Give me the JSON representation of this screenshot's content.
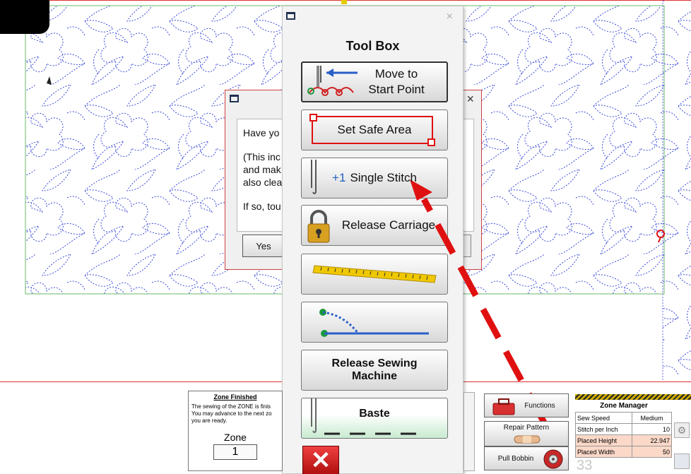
{
  "toolbox": {
    "title": "Tool Box",
    "close": "×",
    "buttons": {
      "move_to_start": [
        "Move to",
        "Start Point"
      ],
      "set_safe_area": "Set Safe Area",
      "single_stitch_prefix": "+1",
      "single_stitch": "Single Stitch",
      "release_carriage": "Release Carriage",
      "release_sewing_machine": [
        "Release Sewing",
        "Machine"
      ],
      "baste": "Baste",
      "cancel": "✕"
    }
  },
  "confirm_dialog": {
    "close": "×",
    "lines": [
      "Have yo",
      "(This inc",
      "and mak",
      "also clea",
      "If so, tou"
    ],
    "yes": "Yes"
  },
  "zone_panel": {
    "heading": "Zone Finished",
    "message": [
      "The sewing of the ZONE is finis",
      "You may advance to the next zo",
      "you are ready."
    ],
    "zone_label": "Zone",
    "zone_number": "1"
  },
  "side_buttons": {
    "functions": "Functions",
    "repair_pattern": "Repair Pattern",
    "pull_bobbin": "Pull Bobbin"
  },
  "zone_manager": {
    "title": "Zone Manager",
    "rows": [
      {
        "label": "Sew Speed",
        "value": "Medium"
      },
      {
        "label": "Stitch per Inch",
        "value": "10"
      },
      {
        "label": "Placed Height",
        "value": "22.947"
      },
      {
        "label": "Placed Width",
        "value": "50"
      }
    ]
  },
  "page_number": "33",
  "colors": {
    "stitch": "#3a4ad8",
    "safe_area": "#e01010",
    "arrow": "#e01010",
    "border_green": "#3aa83a"
  }
}
